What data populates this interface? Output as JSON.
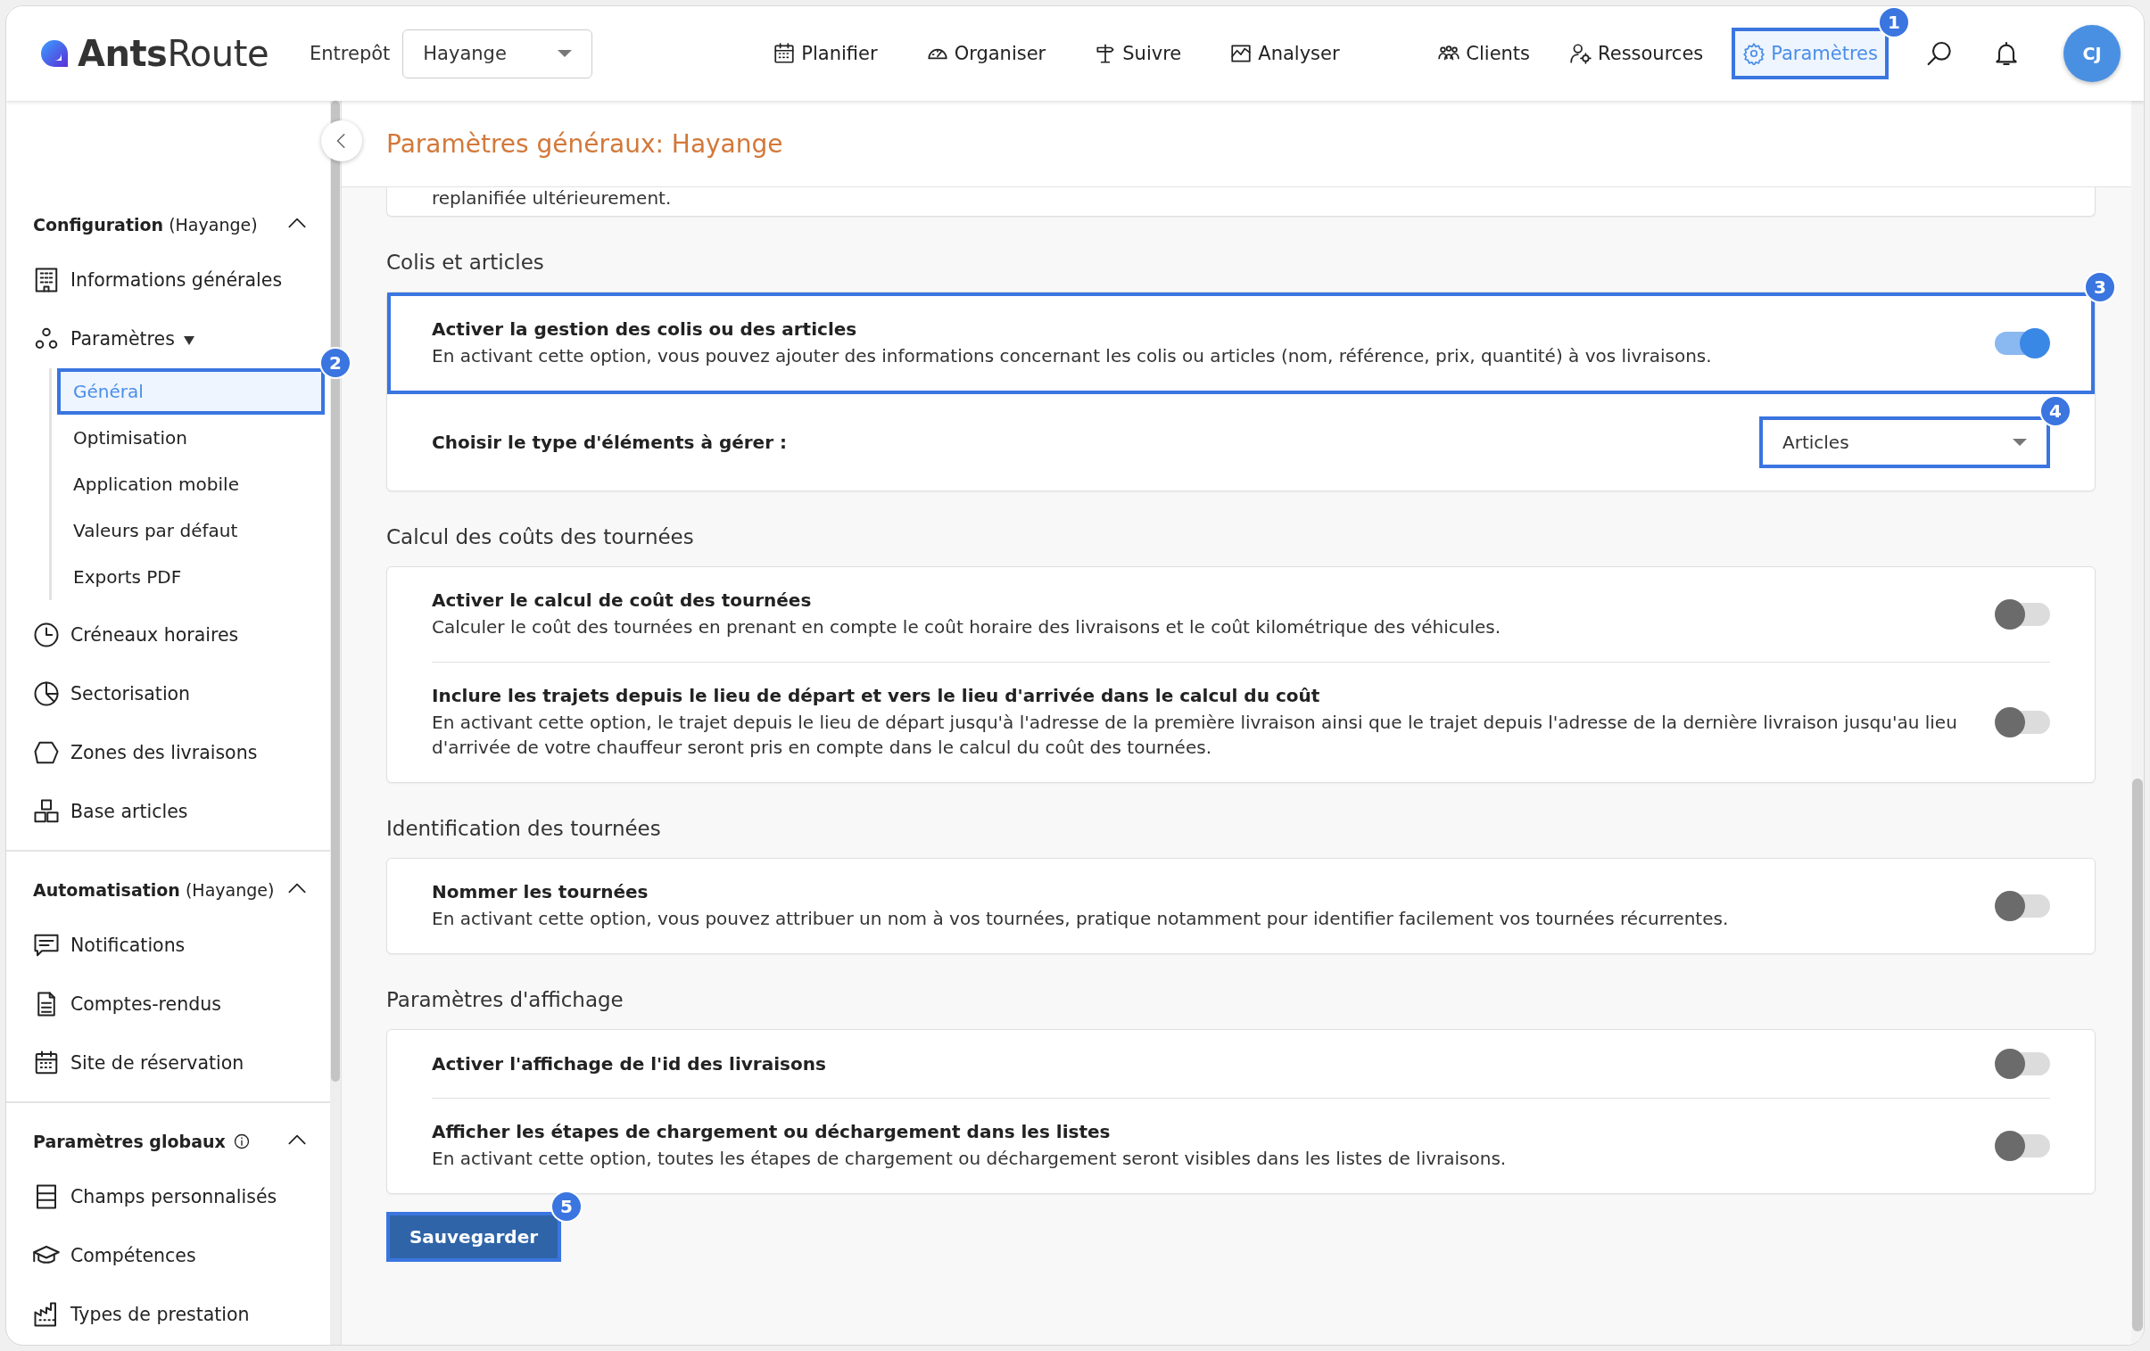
{
  "header": {
    "logo": {
      "strong": "Ants",
      "light": "Route"
    },
    "warehouse": {
      "label": "Entrepôt",
      "value": "Hayange"
    },
    "nav": [
      {
        "label": "Planifier",
        "selected": false
      },
      {
        "label": "Organiser",
        "selected": false
      },
      {
        "label": "Suivre",
        "selected": false
      },
      {
        "label": "Analyser",
        "selected": false
      }
    ],
    "nav_right": [
      {
        "label": "Clients",
        "selected": false
      },
      {
        "label": "Ressources",
        "selected": false
      },
      {
        "label": "Paramètres",
        "selected": true,
        "callout": "1"
      }
    ],
    "avatar": "CJ"
  },
  "sidebar": {
    "sections": [
      {
        "title": "**Configuration** (Hayange)",
        "expanded": true,
        "items": [
          {
            "label": "Informations générales",
            "selected": false
          },
          {
            "label": "Paramètres",
            "selected": false,
            "expanded": true,
            "children": [
              {
                "label": "Général",
                "selected": true,
                "callout": "2"
              },
              {
                "label": "Optimisation",
                "selected": false
              },
              {
                "label": "Application mobile",
                "selected": false
              },
              {
                "label": "Valeurs par défaut",
                "selected": false
              },
              {
                "label": "Exports PDF",
                "selected": false
              }
            ]
          },
          {
            "label": "Créneaux horaires",
            "selected": false
          },
          {
            "label": "Sectorisation",
            "selected": false
          },
          {
            "label": "Zones des livraisons",
            "selected": false
          },
          {
            "label": "Base articles",
            "selected": false
          }
        ]
      },
      {
        "title": "**Automatisation** (Hayange)",
        "expanded": true,
        "items": [
          {
            "label": "Notifications",
            "selected": false
          },
          {
            "label": "Comptes-rendus",
            "selected": false
          },
          {
            "label": "Site de réservation",
            "selected": false
          }
        ]
      },
      {
        "title": "**Paramètres globaux**",
        "info": true,
        "expanded": true,
        "items": [
          {
            "label": "Champs personnalisés",
            "selected": false
          },
          {
            "label": "Compétences",
            "selected": false
          },
          {
            "label": "Types de prestation",
            "selected": false
          }
        ]
      }
    ]
  },
  "page_title": "Paramètres généraux: Hayange",
  "sections": [
    {
      "rows": [
        {
          "kind": "note",
          "text": "replanifiée ultérieurement."
        }
      ]
    },
    {
      "title": "Colis et articles",
      "rows": [
        {
          "kind": "toggle",
          "title": "Activer la gestion des colis ou des articles",
          "description": "En activant cette option, vous pouvez ajouter des informations concernant les colis ou articles (nom, référence, prix, quantité) à vos livraisons.",
          "on": true,
          "callout": "3"
        },
        {
          "kind": "select",
          "title": "Choisir le type d'éléments à gérer :",
          "value": "Articles",
          "callout": "4"
        }
      ]
    },
    {
      "title": "Calcul des coûts des tournées",
      "rows": [
        {
          "kind": "toggle",
          "title": "Activer le calcul de coût des tournées",
          "description": "Calculer le coût des tournées en prenant en compte le coût horaire des livraisons et le coût kilométrique des véhicules.",
          "on": false
        },
        {
          "kind": "toggle",
          "title": "Inclure les trajets depuis le lieu de départ et vers le lieu d'arrivée dans le calcul du coût",
          "description": "En activant cette option, le trajet depuis le lieu de départ jusqu'à l'adresse de la première livraison ainsi que le trajet depuis l'adresse de la dernière livraison jusqu'au lieu d'arrivée de votre chauffeur seront pris en compte dans le calcul du coût des tournées.",
          "on": false
        }
      ]
    },
    {
      "title": "Identification des tournées",
      "rows": [
        {
          "kind": "toggle",
          "title": "Nommer les tournées",
          "description": "En activant cette option, vous pouvez attribuer un nom à vos tournées, pratique notamment pour identifier facilement vos tournées récurrentes.",
          "on": false
        }
      ]
    },
    {
      "title": "Paramètres d'affichage",
      "rows": [
        {
          "kind": "toggle",
          "title": "Activer l'affichage de l'id des livraisons",
          "on": false
        },
        {
          "kind": "toggle",
          "title": "Afficher les étapes de chargement ou déchargement dans les listes",
          "description": "En activant cette option, toutes les étapes de chargement ou déchargement seront visibles dans les listes de livraisons.",
          "on": false
        }
      ]
    }
  ],
  "save": {
    "label": "Sauvegarder",
    "callout": "5"
  }
}
